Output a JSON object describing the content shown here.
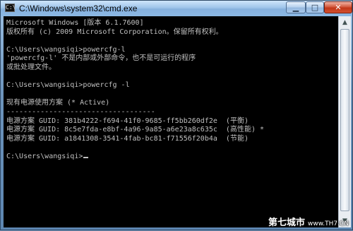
{
  "window": {
    "title": "C:\\Windows\\system32\\cmd.exe",
    "app_icon_text": "C:\\",
    "controls": {
      "minimize": "▁",
      "maximize": "□",
      "close": "✕"
    }
  },
  "console": {
    "lines": [
      "Microsoft Windows [版本 6.1.7600]",
      "版权所有 (c) 2009 Microsoft Corporation。保留所有权利。",
      "",
      "C:\\Users\\wangsiqi>powercfg-l",
      "'powercfg-l' 不是内部或外部命令，也不是可运行的程序",
      "或批处理文件。",
      "",
      "C:\\Users\\wangsiqi>powercfg -l",
      "",
      "现有电源使用方案 (* Active)",
      "-----------------------------------",
      "电源方案 GUID: 381b4222-f694-41f0-9685-ff5bb260df2e  (平衡)",
      "电源方案 GUID: 8c5e7fda-e8bf-4a96-9a85-a6e23a8c635c  (高性能) *",
      "电源方案 GUID: a1841308-3541-4fab-bc81-f71556f20b4a  (节能)",
      "",
      "C:\\Users\\wangsiqi>"
    ]
  },
  "scrollbar": {
    "up_arrow": "▲",
    "down_arrow": "▼"
  },
  "watermark": {
    "text": "第七城市",
    "url": "www.TH7.CN"
  }
}
